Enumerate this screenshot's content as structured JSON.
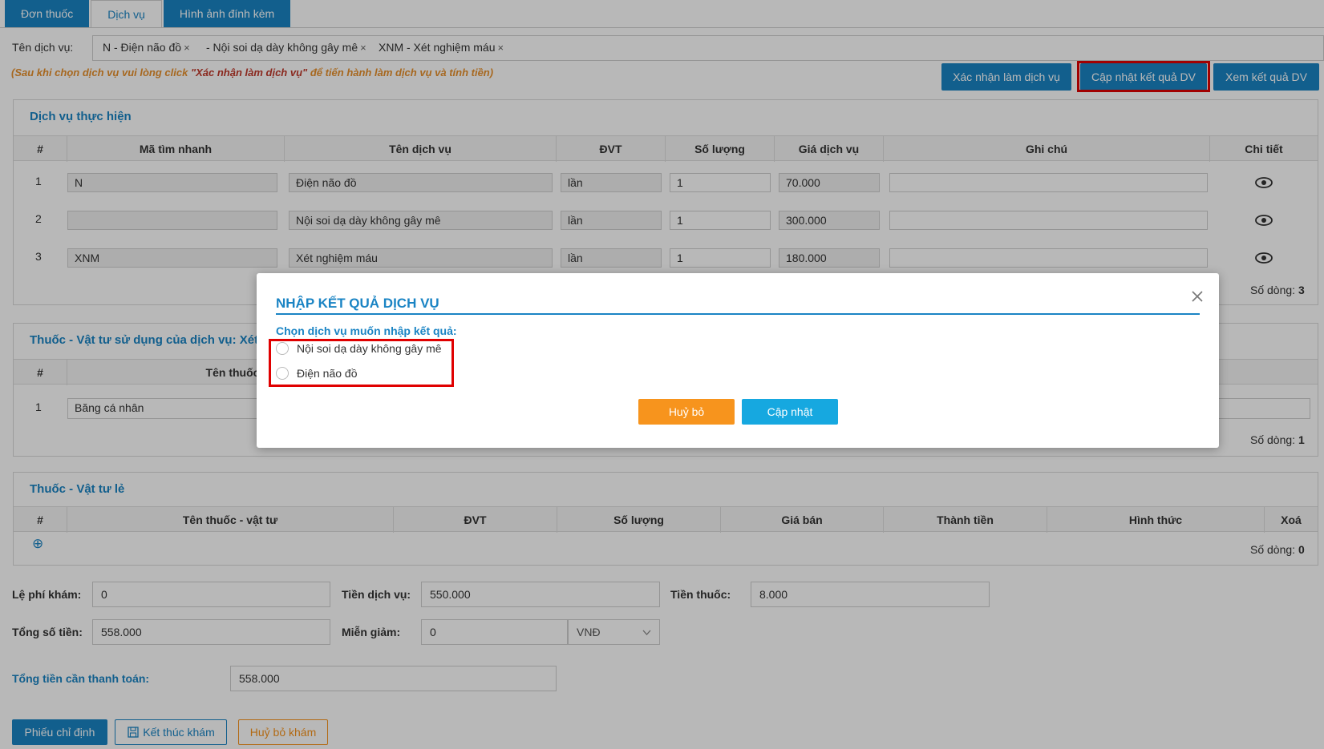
{
  "tabs": [
    "Đơn thuốc",
    "Dịch vụ",
    "Hình ảnh đính kèm"
  ],
  "service_selector": {
    "label": "Tên dịch vụ:",
    "chips": [
      "N - Điện não đồ",
      "- Nội soi dạ dày không gây mê",
      "XNM - Xét nghiệm máu"
    ],
    "remove_glyph": "×"
  },
  "note": {
    "prefix": "(Sau khi chọn dịch vụ vui lòng click ",
    "emph": "\"Xác nhận làm dịch vụ\"",
    "suffix": " để tiến hành làm dịch vụ và tính tiền)"
  },
  "actions": {
    "confirm": "Xác nhận làm dịch vụ",
    "update_result": "Cập nhật kết quả DV",
    "view_result": "Xem kết quả DV"
  },
  "services": {
    "title": "Dịch vụ thực hiện",
    "headers": [
      "#",
      "Mã tìm nhanh",
      "Tên dịch vụ",
      "ĐVT",
      "Số lượng",
      "Giá dịch vụ",
      "Ghi chú",
      "Chi tiết"
    ],
    "rows": [
      {
        "no": "1",
        "code": "N",
        "name": "Điện não đồ",
        "unit": "lần",
        "qty": "1",
        "price": "70.000",
        "note": ""
      },
      {
        "no": "2",
        "code": "",
        "name": "Nội soi dạ dày không gây mê",
        "unit": "lần",
        "qty": "1",
        "price": "300.000",
        "note": ""
      },
      {
        "no": "3",
        "code": "XNM",
        "name": "Xét nghiệm máu",
        "unit": "lần",
        "qty": "1",
        "price": "180.000",
        "note": ""
      }
    ],
    "row_count_label": "Số dòng:",
    "row_count": "3"
  },
  "supplies": {
    "title": "Thuốc - Vật tư sử dụng của dịch vụ: Xét ng",
    "headers": [
      "#",
      "Tên thuốc - vậ"
    ],
    "rows": [
      {
        "no": "1",
        "name": "Băng cá nhân"
      }
    ],
    "row_count_label": "Số dòng:",
    "row_count": "1"
  },
  "retail": {
    "title": "Thuốc - Vật tư lẻ",
    "headers": [
      "#",
      "Tên thuốc - vật tư",
      "ĐVT",
      "Số lượng",
      "Giá bán",
      "Thành tiền",
      "Hình thức",
      "Xoá"
    ],
    "add_glyph": "⊕",
    "row_count_label": "Số dòng:",
    "row_count": "0"
  },
  "totals": {
    "exam_fee_label": "Lệ phí khám:",
    "exam_fee": "0",
    "service_fee_label": "Tiền dịch vụ:",
    "service_fee": "550.000",
    "drug_fee_label": "Tiền thuốc:",
    "drug_fee": "8.000",
    "total_label": "Tổng số tiền:",
    "total": "558.000",
    "discount_label": "Miễn giảm:",
    "discount": "0",
    "currency": "VNĐ",
    "payable_label": "Tổng tiền cần thanh toán:",
    "payable": "558.000"
  },
  "footer": {
    "order_slip": "Phiếu chỉ định",
    "finish": "Kết thúc khám",
    "cancel": "Huỷ bỏ khám"
  },
  "modal": {
    "title": "NHẬP KẾT QUẢ DỊCH VỤ",
    "subtitle": "Chọn dịch vụ muốn nhập kết quả:",
    "options": [
      "Nội soi dạ dày không gây mê",
      "Điện não đồ"
    ],
    "cancel": "Huỷ bỏ",
    "update": "Cập nhật"
  },
  "colors": {
    "primary": "#1a84c4",
    "warning": "#f7941d",
    "highlight": "#e00000",
    "cyan": "#16a8e0"
  }
}
